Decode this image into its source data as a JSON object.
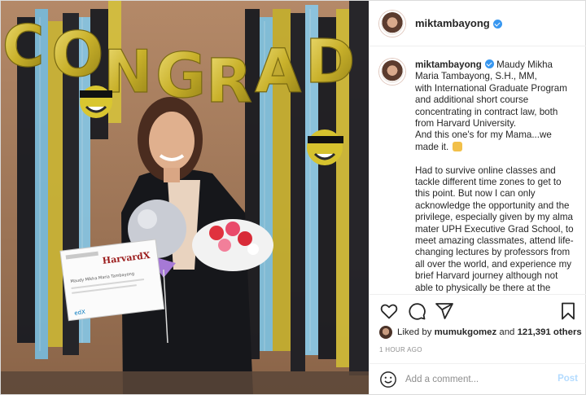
{
  "post": {
    "username": "miktambayong",
    "caption_user": "miktambayong",
    "caption_lines": [
      "Maudy Mikha",
      "Maria Tambayong, S.H., MM,",
      "with International Graduate Program",
      "and additional short course",
      "concentrating in contract law, both",
      "from Harvard University.",
      "And this one's for my Mama...we",
      "made it."
    ],
    "caption_para2": [
      "Had to survive online classes and",
      "tackle different time zones to get to",
      "this point. But now I can only",
      "acknowledge the opportunity and the",
      "privilege, especially given by my alma",
      "mater UPH Executive Grad School, to",
      "meet amazing classmates, attend life-",
      "changing lectures by professors from",
      "all over the world, and experience my",
      "brief Harvard journey although not",
      "able to physically be there at the"
    ],
    "likes_prefix": "Liked by ",
    "likes_user": "mumukgomez",
    "likes_mid": " and ",
    "likes_count": "121,391 others",
    "timestamp": "1 HOUR AGO",
    "comment_placeholder": "Add a comment...",
    "post_label": "Post"
  },
  "photo": {
    "balloon_letters": [
      "C",
      "O",
      "N",
      "G",
      "R",
      "A",
      "D"
    ],
    "certificate_brand": "HarvardX",
    "certificate_badge": "edX",
    "certificate_name": "Maudy Mikha Maria Tambayong"
  },
  "icons": {
    "like": "heart-icon",
    "comment": "comment-icon",
    "share": "share-icon",
    "save": "bookmark-icon",
    "verified": "verified-badge-icon",
    "emoji": "smiling-face-emoji-icon"
  },
  "colors": {
    "verified": "#3897f0",
    "post_button": "#b3dbff",
    "muted_text": "#8e8e8e",
    "balloon_gold": "#d8c23a"
  }
}
